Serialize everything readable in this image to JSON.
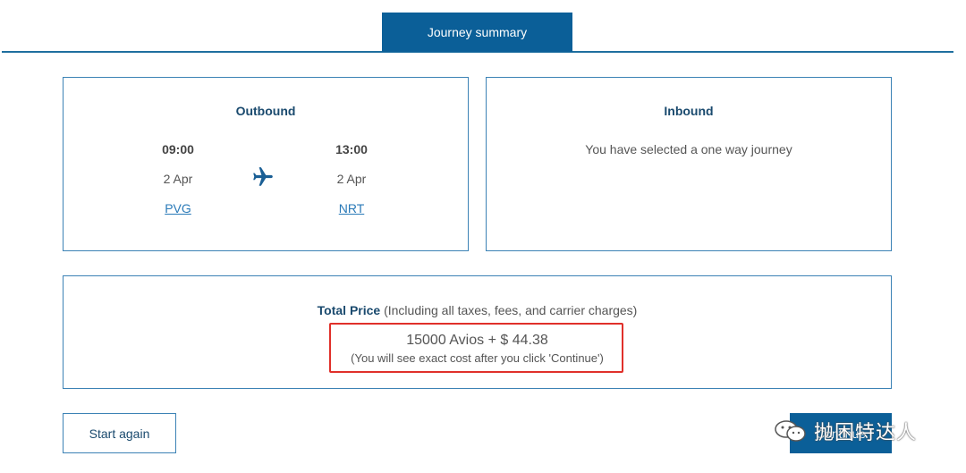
{
  "tabs": {
    "active_label": "Journey summary"
  },
  "outbound": {
    "title": "Outbound",
    "departure": {
      "time": "09:00",
      "date": "2 Apr",
      "airport": "PVG"
    },
    "arrival": {
      "time": "13:00",
      "date": "2 Apr",
      "airport": "NRT"
    },
    "icon": "plane-icon"
  },
  "inbound": {
    "title": "Inbound",
    "message": "You have selected a one way journey"
  },
  "total": {
    "label": "Total Price",
    "label_note": " (Including all taxes, fees, and carrier charges)",
    "price": "15000 Avios + $ 44.38",
    "note": "(You will see exact cost after you click 'Continue')"
  },
  "actions": {
    "start_again": "Start again",
    "continue": "Continue"
  },
  "watermark": {
    "text": "抛困特达人",
    "icon": "wechat-icon"
  },
  "colors": {
    "brand": "#0b5f98",
    "border": "#3c82b5",
    "link": "#2a7ab8",
    "highlight": "#e0302a"
  }
}
